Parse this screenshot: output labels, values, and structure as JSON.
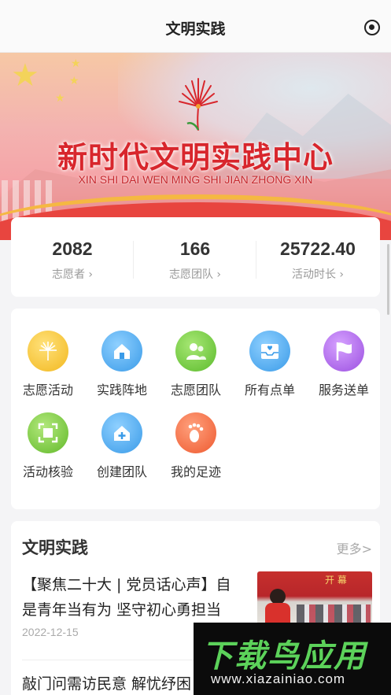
{
  "topbar": {
    "title": "文明实践",
    "action_icon": "target-icon"
  },
  "banner": {
    "headline": "新时代文明实践中心",
    "pinyin": "XIN SHI DAI WEN MING SHI JIAN ZHONG XIN",
    "emblem_icon": "dandelion-emblem-icon",
    "colors": {
      "headline": "#d8262c",
      "wave": "#e8453f",
      "gold": "#f5b842"
    }
  },
  "stats": [
    {
      "value": "2082",
      "label": "志愿者 ›"
    },
    {
      "value": "166",
      "label": "志愿团队 ›"
    },
    {
      "value": "25722.40",
      "label": "活动时长 ›"
    }
  ],
  "menu": {
    "items": [
      {
        "label": "志愿活动",
        "icon": "dandelion-icon",
        "color": "#f5c533"
      },
      {
        "label": "实践阵地",
        "icon": "home-icon",
        "color": "#4aa8ee"
      },
      {
        "label": "志愿团队",
        "icon": "team-icon",
        "color": "#6fcc3f"
      },
      {
        "label": "所有点单",
        "icon": "inbox-heart-icon",
        "color": "#43a9f0"
      },
      {
        "label": "服务送单",
        "icon": "flag-icon",
        "color": "#b067e6"
      },
      {
        "label": "活动核验",
        "icon": "scan-icon",
        "color": "#78cc3d"
      },
      {
        "label": "创建团队",
        "icon": "home-plus-icon",
        "color": "#44a6ee"
      },
      {
        "label": "我的足迹",
        "icon": "footprint-icon",
        "color": "#f46b44"
      }
    ]
  },
  "news": {
    "heading": "文明实践",
    "more_label": "更多>",
    "items": [
      {
        "title": "【聚焦二十大 | 党员话心声】自是青年当有为 坚守初心勇担当",
        "date": "2022-12-15",
        "thumb_text": "开 幕"
      },
      {
        "title": "敲门问需访民意 解忧纾困"
      }
    ]
  },
  "watermark": {
    "brand": "下载鸟应用",
    "url": "www.xiazainiao.com"
  }
}
